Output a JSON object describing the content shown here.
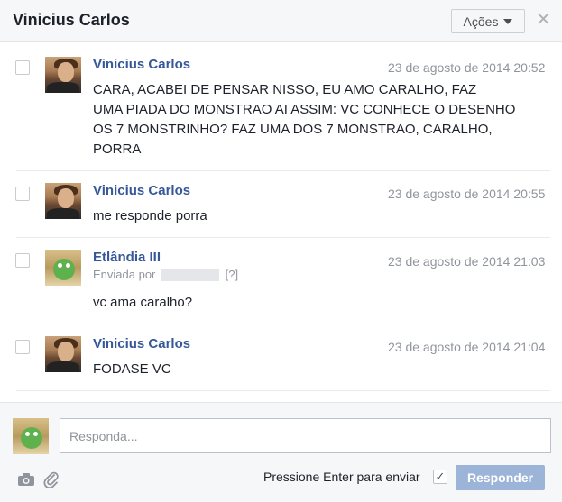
{
  "header": {
    "title": "Vinicius Carlos",
    "actions_label": "Ações",
    "close_glyph": "✕"
  },
  "messages": [
    {
      "sender": "Vinicius Carlos",
      "time": "23 de agosto de 2014 20:52",
      "lines": [
        "CARA, ACABEI DE PENSAR NISSO, EU AMO CARALHO, FAZ",
        "UMA PIADA DO MONSTRAO AI ASSIM: VC CONHECE O DESENHO",
        "OS 7 MONSTRINHO? FAZ UMA DOS 7 MONSTRAO, CARALHO,",
        "PORRA"
      ]
    },
    {
      "sender": "Vinicius Carlos",
      "time": "23 de agosto de 2014 20:55",
      "lines": [
        "me responde porra"
      ]
    },
    {
      "sender": "Etlândia III",
      "sent_by_label": "Enviada por",
      "sent_by_help": "[?]",
      "time": "23 de agosto de 2014 21:03",
      "lines": [
        "vc ama caralho?"
      ]
    },
    {
      "sender": "Vinicius Carlos",
      "time": "23 de agosto de 2014 21:04",
      "lines": [
        "FODASE VC"
      ]
    }
  ],
  "composer": {
    "placeholder": "Responda...",
    "enter_label": "Pressione Enter para enviar",
    "enter_checked": true,
    "send_label": "Responder"
  }
}
